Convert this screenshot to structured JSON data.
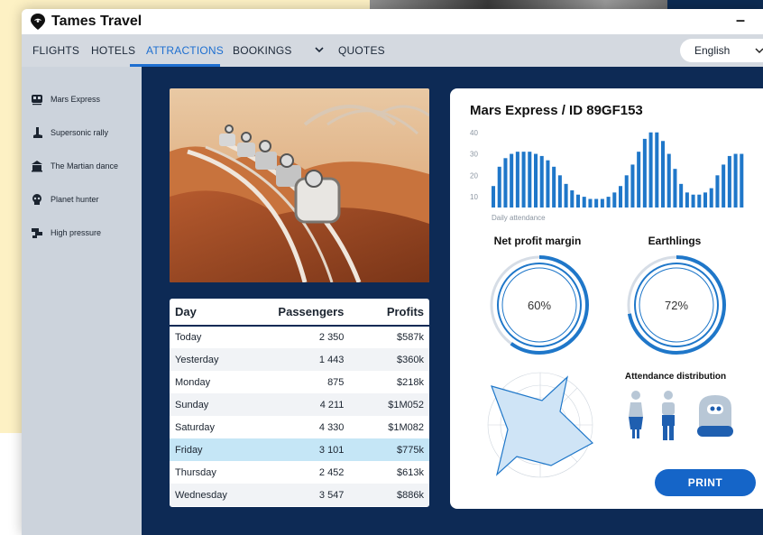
{
  "app": {
    "title": "Tames Travel",
    "minimize_label": "–"
  },
  "nav": {
    "tabs": [
      {
        "label": "FLIGHTS"
      },
      {
        "label": "HOTELS"
      },
      {
        "label": "ATTRACTIONS",
        "active": true
      },
      {
        "label": "BOOKINGS"
      },
      {
        "label": "QUOTES"
      }
    ],
    "language": "English"
  },
  "sidebar": {
    "items": [
      {
        "label": "Mars Express",
        "icon": "train-icon"
      },
      {
        "label": "Supersonic rally",
        "icon": "boot-icon"
      },
      {
        "label": "The Martian dance",
        "icon": "theater-icon"
      },
      {
        "label": "Planet hunter",
        "icon": "alien-icon"
      },
      {
        "label": "High pressure",
        "icon": "pipes-icon"
      }
    ]
  },
  "table": {
    "headers": {
      "day": "Day",
      "passengers": "Passengers",
      "profits": "Profits"
    },
    "rows": [
      {
        "day": "Today",
        "passengers": "2 350",
        "profits": "$587k"
      },
      {
        "day": "Yesterday",
        "passengers": "1 443",
        "profits": "$360k"
      },
      {
        "day": "Monday",
        "passengers": "875",
        "profits": "$218k"
      },
      {
        "day": "Sunday",
        "passengers": "4 211",
        "profits": "$1M052"
      },
      {
        "day": "Saturday",
        "passengers": "4 330",
        "profits": "$1M082"
      },
      {
        "day": "Friday",
        "passengers": "3 101",
        "profits": "$775k",
        "selected": true
      },
      {
        "day": "Thursday",
        "passengers": "2 452",
        "profits": "$613k"
      },
      {
        "day": "Wednesday",
        "passengers": "3 547",
        "profits": "$886k"
      }
    ]
  },
  "dashboard": {
    "title": "Mars Express / ID 89GF153",
    "gauges": [
      {
        "title": "Net profit margin",
        "value": "60%",
        "fraction": 0.6
      },
      {
        "title": "Earthlings",
        "value": "72%",
        "fraction": 0.72
      }
    ],
    "attendance_title": "Attendance distribution",
    "print_label": "PRINT",
    "colors": {
      "accent": "#1e6fd0",
      "dark": "#0d2a55",
      "bar": "#1f77c9",
      "radar_fill": "#cfe4f6"
    }
  },
  "chart_data": {
    "type": "bar",
    "xlabel": "Daily attendance",
    "ylabel": "",
    "ylim": [
      5,
      42
    ],
    "yticks": [
      40,
      30,
      20,
      10
    ],
    "values": [
      15,
      24,
      28,
      30,
      31,
      31,
      31,
      30,
      29,
      27,
      24,
      20,
      16,
      13,
      11,
      10,
      9,
      9,
      9,
      10,
      12,
      15,
      20,
      25,
      31,
      37,
      40,
      40,
      36,
      30,
      23,
      16,
      12,
      11,
      11,
      12,
      14,
      20,
      25,
      29,
      30,
      30
    ]
  }
}
